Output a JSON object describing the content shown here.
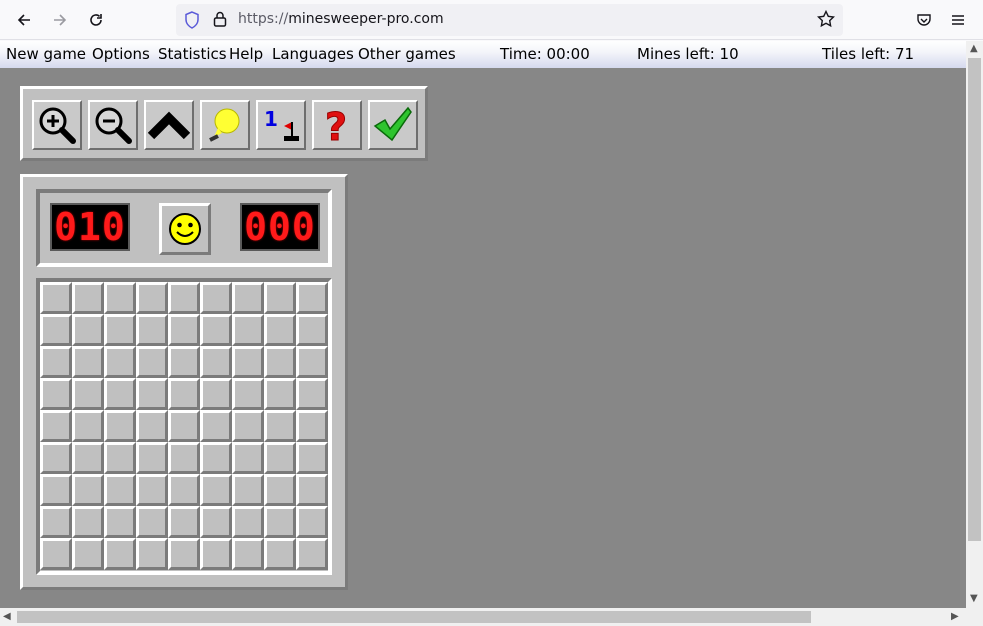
{
  "browser": {
    "url_protocol": "https://",
    "url_host": "minesweeper-pro.com",
    "icons": [
      "back-arrow-icon",
      "forward-arrow-icon",
      "reload-icon",
      "shield-icon",
      "lock-icon",
      "star-icon",
      "pocket-icon",
      "hamburger-menu-icon"
    ]
  },
  "menu": {
    "items": [
      "New game",
      "Options",
      "Statistics",
      "Help",
      "Languages",
      "Other games"
    ],
    "time": "Time: 00:00",
    "mines_left": "Mines left: 10",
    "tiles_left": "Tiles left: 71"
  },
  "toolbar": {
    "tools": [
      "zoom-in-icon",
      "zoom-out-icon",
      "chevron-up-icon",
      "lightbulb-icon",
      "number-flag-icon",
      "question-mark-icon",
      "checkmark-icon"
    ]
  },
  "game": {
    "mine_counter": "010",
    "timer": "000",
    "smiley": "smiley-face-icon",
    "rows": 9,
    "cols": 9
  },
  "colors": {
    "page_bg": "#878787",
    "panel": "#c0c0c0",
    "lcd_digit": "#ff1a1a",
    "check": "#2fc42f",
    "question": "#e01010",
    "bulb": "#ffff33"
  }
}
